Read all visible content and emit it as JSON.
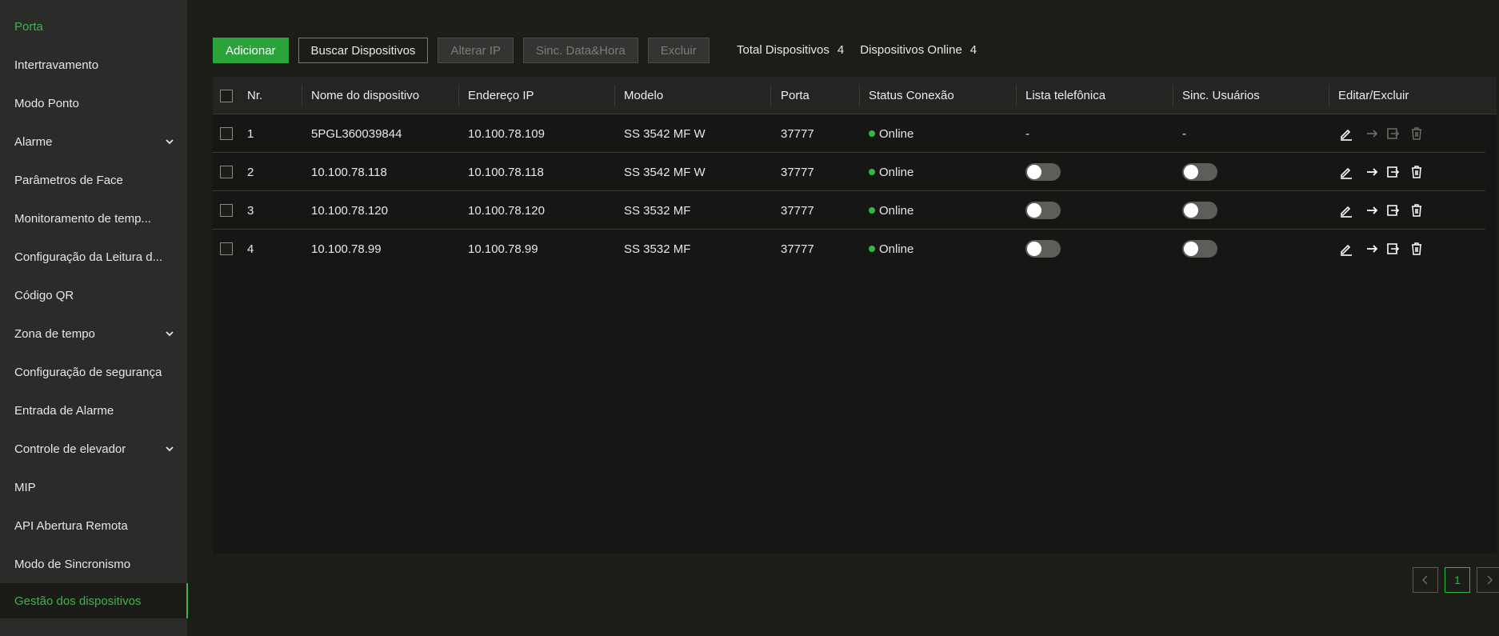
{
  "sidebar": {
    "items": [
      {
        "label": "Porta"
      },
      {
        "label": "Intertravamento"
      },
      {
        "label": "Modo Ponto"
      },
      {
        "label": "Alarme"
      },
      {
        "label": "Parâmetros de Face"
      },
      {
        "label": "Monitoramento de temp..."
      },
      {
        "label": "Configuração da Leitura d..."
      },
      {
        "label": "Código QR"
      },
      {
        "label": "Zona de tempo"
      },
      {
        "label": "Configuração de segurança"
      },
      {
        "label": "Entrada de Alarme"
      },
      {
        "label": "Controle de elevador"
      },
      {
        "label": "MIP"
      },
      {
        "label": "API Abertura Remota"
      },
      {
        "label": "Modo de Sincronismo"
      },
      {
        "label": "Gestão dos dispositivos"
      }
    ]
  },
  "toolbar": {
    "add": "Adicionar",
    "search": "Buscar Dispositivos",
    "change_ip": "Alterar IP",
    "sync_datetime": "Sinc. Data&Hora",
    "delete": "Excluir"
  },
  "stats": {
    "total_label": "Total Dispositivos",
    "total_value": "4",
    "online_label": "Dispositivos Online",
    "online_value": "4"
  },
  "table": {
    "headers": {
      "nr": "Nr.",
      "name": "Nome do dispositivo",
      "ip": "Endereço IP",
      "model": "Modelo",
      "port": "Porta",
      "status": "Status Conexão",
      "phonebook": "Lista telefônica",
      "sync_users": "Sinc. Usuários",
      "edit_delete": "Editar/Excluir"
    },
    "rows": [
      {
        "nr": "1",
        "name": "5PGL360039844",
        "ip": "10.100.78.109",
        "model": "SS 3542 MF W",
        "port": "37777",
        "status": "Online",
        "phonebook": "-",
        "sync_users": "-"
      },
      {
        "nr": "2",
        "name": "10.100.78.118",
        "ip": "10.100.78.118",
        "model": "SS 3542 MF W",
        "port": "37777",
        "status": "Online",
        "phonebook": false,
        "sync_users": false
      },
      {
        "nr": "3",
        "name": "10.100.78.120",
        "ip": "10.100.78.120",
        "model": "SS 3532 MF",
        "port": "37777",
        "status": "Online",
        "phonebook": false,
        "sync_users": false
      },
      {
        "nr": "4",
        "name": "10.100.78.99",
        "ip": "10.100.78.99",
        "model": "SS 3532 MF",
        "port": "37777",
        "status": "Online",
        "phonebook": false,
        "sync_users": false
      }
    ]
  },
  "pagination": {
    "current_page": "1"
  },
  "colors": {
    "accent": "#2aa33b",
    "online": "#2fb84a",
    "sidebar_bg": "#2b2b29",
    "page_bg": "#1c1c19"
  }
}
